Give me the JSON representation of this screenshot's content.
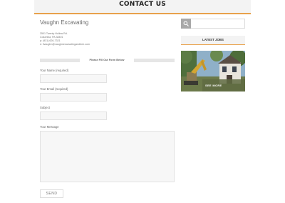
{
  "header": {
    "title": "CONTACT US"
  },
  "company": {
    "name": "Vaughn Excavating",
    "address_line1": "3501 Twenty Hollow Rd.",
    "address_line2": "Columbia, PA 38401",
    "phone": "p: (931) 626-7321",
    "email": "e: llvaughn@vaughnexcavatingandtree.com"
  },
  "form": {
    "separator_text": "Please Fill Out Form Below",
    "name_label": "Your Name (required)",
    "email_label": "Your Email (required)",
    "subject_label": "Subject",
    "message_label": "Your Message",
    "send_label": "SEND",
    "name_value": "",
    "email_value": "",
    "subject_value": "",
    "message_value": ""
  },
  "sidebar": {
    "search_icon": "search-icon",
    "search_placeholder": "",
    "latest_jobs_title": "LATEST JOBS",
    "see_more_label": "SEE MORE"
  },
  "colors": {
    "accent": "#e8a14b",
    "header_bg": "#f3f3f3",
    "search_button": "#a8a8a8"
  }
}
